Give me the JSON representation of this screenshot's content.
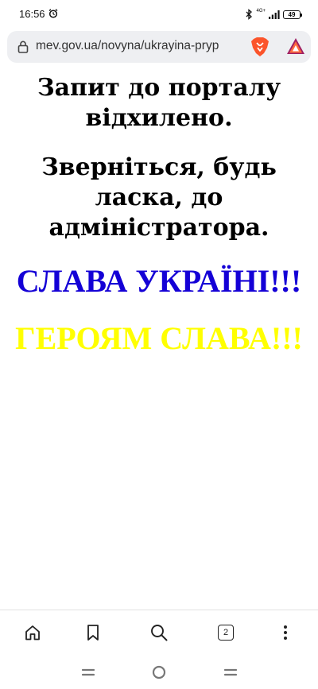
{
  "status_bar": {
    "time": "16:56",
    "network": "4G+",
    "battery": "49",
    "icons": [
      "alarm-icon",
      "bluetooth-icon",
      "signal-icon",
      "battery-icon"
    ]
  },
  "browser": {
    "url": "mev.gov.ua/novyna/ukrayina-pryp",
    "icons": [
      "lock-icon",
      "brave-shield-icon",
      "bat-rewards-icon"
    ],
    "tab_count": "2",
    "toolbar_icons": [
      "home-icon",
      "bookmark-icon",
      "search-icon",
      "tabs-icon",
      "menu-icon"
    ]
  },
  "page": {
    "line1": "Запит до порталу відхилено.",
    "line2": "Зверніться, будь ласка, до адміністратора.",
    "slava_ukraini": "СЛАВА УКРАЇНІ!!!",
    "heroyam_slava": "ГЕРОЯМ СЛАВА!!!",
    "colors": {
      "slava_ukraini": "#1400d6",
      "heroyam_slava": "#ffff00"
    }
  },
  "nav_bar": {
    "icons": [
      "recent-apps-icon",
      "home-circle-icon",
      "back-icon"
    ]
  }
}
